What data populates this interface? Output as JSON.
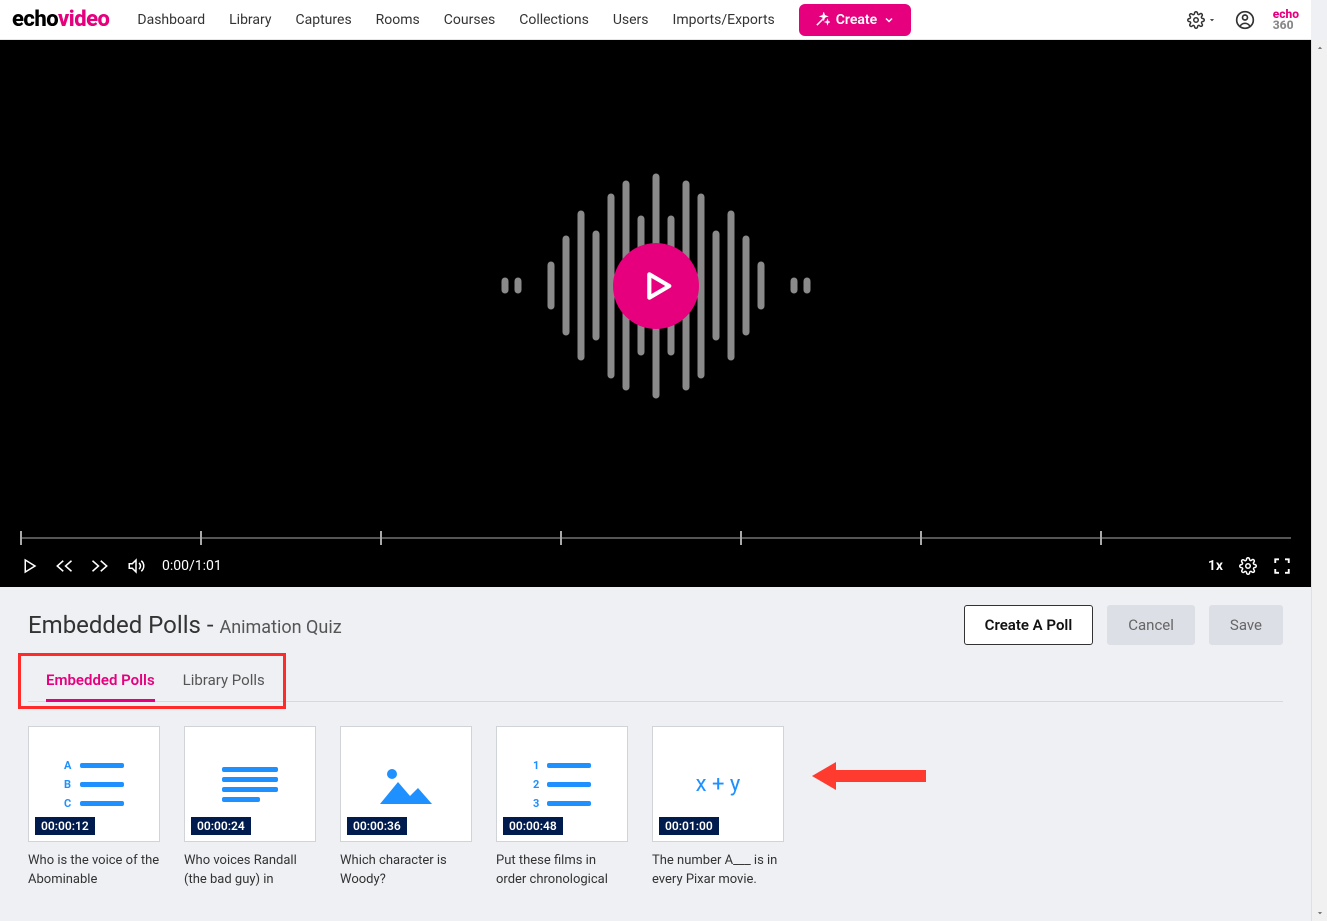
{
  "logo": {
    "part1": "echo",
    "part2": "video"
  },
  "nav": {
    "items": [
      "Dashboard",
      "Library",
      "Captures",
      "Rooms",
      "Courses",
      "Collections",
      "Users",
      "Imports/Exports"
    ],
    "create": "Create"
  },
  "player": {
    "time": "0:00/1:01",
    "speed": "1x"
  },
  "panel": {
    "title": "Embedded Polls - ",
    "subtitle": "Animation Quiz",
    "create_poll": "Create A Poll",
    "cancel": "Cancel",
    "save": "Save"
  },
  "tabs": {
    "embedded": "Embedded Polls",
    "library": "Library Polls"
  },
  "polls": [
    {
      "ts": "00:00:12",
      "caption": "Who is the voice of the Abominable",
      "type": "mc"
    },
    {
      "ts": "00:00:24",
      "caption": "Who voices Randall (the bad guy) in",
      "type": "para"
    },
    {
      "ts": "00:00:36",
      "caption": "Which character is Woody?",
      "type": "image"
    },
    {
      "ts": "00:00:48",
      "caption": "Put these films in order chronological",
      "type": "order"
    },
    {
      "ts": "00:01:00",
      "caption": "The number A___ is in every Pixar movie.",
      "type": "formula",
      "formula": "x + y"
    }
  ],
  "mc_letters": [
    "A",
    "B",
    "C"
  ],
  "order_nums": [
    "1",
    "2",
    "3"
  ]
}
